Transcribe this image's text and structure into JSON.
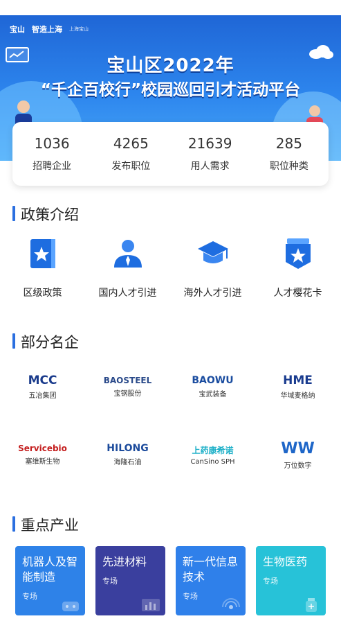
{
  "hero": {
    "logos": [
      "宝山",
      "智造上海",
      "上海宝山"
    ],
    "title_line1": "宝山区2022年",
    "title_line2": "“千企百校行”校园巡回引才活动平台"
  },
  "stats": [
    {
      "value": "1036",
      "label": "招聘企业"
    },
    {
      "value": "4265",
      "label": "发布职位"
    },
    {
      "value": "21639",
      "label": "用人需求"
    },
    {
      "value": "285",
      "label": "职位种类"
    }
  ],
  "sections": {
    "policy": "政策介绍",
    "companies": "部分名企",
    "industries": "重点产业"
  },
  "policy_items": [
    {
      "label": "区级政策",
      "icon": "book-star-icon"
    },
    {
      "label": "国内人才引进",
      "icon": "person-icon"
    },
    {
      "label": "海外人才引进",
      "icon": "graduation-cap-icon"
    },
    {
      "label": "人才樱花卡",
      "icon": "badge-star-icon"
    }
  ],
  "companies_row1": [
    {
      "main": "MCC",
      "sub": "五冶集团",
      "color": "#1a3b8c"
    },
    {
      "main": "BAOSTEEL",
      "sub": "宝钢股份",
      "color": "#2a4a8a"
    },
    {
      "main": "BAOWU",
      "sub": "宝武装备",
      "color": "#1b4da0"
    },
    {
      "main": "HME",
      "sub": "华域麦格纳",
      "color": "#1a3c8f"
    }
  ],
  "companies_row2": [
    {
      "main": "Servicebio",
      "sub": "塞维斯生物",
      "color": "#c41e1e"
    },
    {
      "main": "HILONG",
      "sub": "海隆石油",
      "color": "#1c4b9c"
    },
    {
      "main": "上药康希诺",
      "sub": "CanSino SPH",
      "color": "#1db0c8"
    },
    {
      "main": "WW",
      "sub": "万位数字",
      "color": "#1e66c8"
    }
  ],
  "industries": [
    {
      "name": "机器人及智能制造",
      "sub": "专场",
      "color": "#2e82e8"
    },
    {
      "name": "先进材料",
      "sub": "专场",
      "color": "#3a3f9e"
    },
    {
      "name": "新一代信息技术",
      "sub": "专场",
      "color": "#2f80ea"
    },
    {
      "name": "生物医药",
      "sub": "专场",
      "color": "#27c2d8"
    }
  ]
}
